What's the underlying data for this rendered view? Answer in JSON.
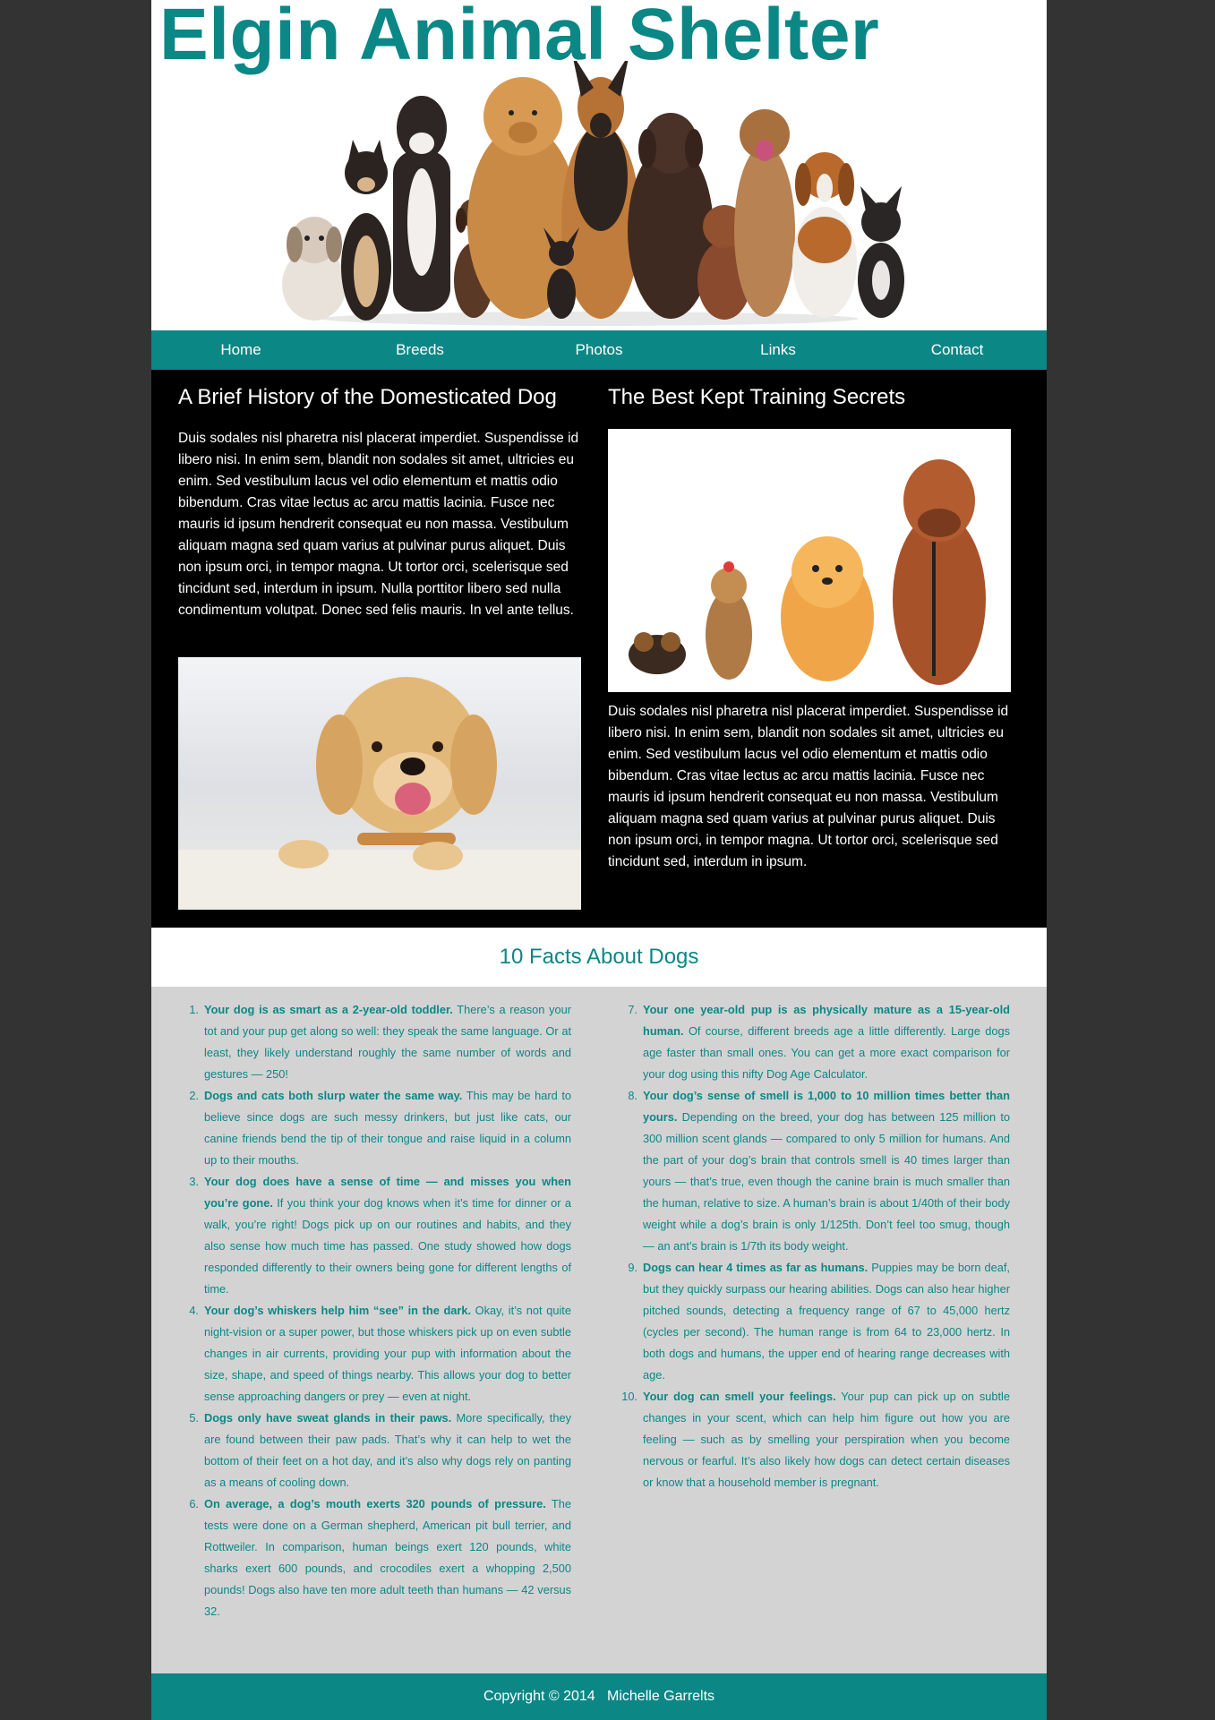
{
  "header": {
    "site_title": "Elgin Animal Shelter",
    "banner_image": "group-of-dogs-banner"
  },
  "nav": {
    "items": [
      {
        "label": "Home"
      },
      {
        "label": "Breeds"
      },
      {
        "label": "Photos"
      },
      {
        "label": "Links"
      },
      {
        "label": "Contact"
      }
    ]
  },
  "main": {
    "left": {
      "title": "A Brief History of the Domesticated Dog",
      "text": "Duis sodales nisl pharetra nisl placerat imperdiet. Suspendisse id libero nisi. In enim sem, blandit non sodales sit amet, ultricies eu enim. Sed vestibulum lacus vel odio elementum et mattis odio bibendum. Cras vitae lectus ac arcu mattis lacinia. Fusce nec mauris id ipsum hendrerit consequat eu non massa. Vestibulum aliquam magna sed quam varius at pulvinar purus aliquet. Duis non ipsum orci, in tempor magna. Ut tortor orci, scelerisque sed tincidunt sed, interdum in ipsum. Nulla porttitor libero sed nulla condimentum volutpat. Donec sed felis mauris. In vel ante tellus.",
      "image": "golden-puppy-photo"
    },
    "right": {
      "title": "The Best Kept Training Secrets",
      "image": "dogs-by-size-photo",
      "text": "Duis sodales nisl pharetra nisl placerat imperdiet. Suspendisse id libero nisi. In enim sem, blandit non sodales sit amet, ultricies eu enim. Sed vestibulum lacus vel odio elementum et mattis odio bibendum. Cras vitae lectus ac arcu mattis lacinia. Fusce nec mauris id ipsum hendrerit consequat eu non massa. Vestibulum aliquam magna sed quam varius at pulvinar purus aliquet. Duis non ipsum orci, in tempor magna. Ut tortor orci, scelerisque sed tincidunt sed, interdum in ipsum."
    }
  },
  "facts": {
    "title": "10 Facts About Dogs",
    "items": [
      {
        "num": "1.",
        "lead": "Your dog is as smart as a 2-year-old toddler.",
        "body": " There’s a reason your tot and your pup get along so well: they speak the same language. Or at least, they likely understand roughly the same number of words and gestures — 250!"
      },
      {
        "num": "2.",
        "lead": "Dogs and cats both slurp water the same way.",
        "body": " This may be hard to believe since dogs are such messy drinkers, but just like cats, our canine friends bend the tip of their tongue and raise liquid in a column up to their mouths."
      },
      {
        "num": "3.",
        "lead": "Your dog does have a sense of time — and misses you when you’re gone.",
        "body": " If you think your dog knows when it’s time for dinner or a walk, you’re right! Dogs pick up on our routines and habits, and they also sense how much time has passed. One study showed how dogs responded differently to their owners being gone for different lengths of time."
      },
      {
        "num": "4.",
        "lead": "Your dog’s whiskers help him “see” in the dark.",
        "body": " Okay, it’s not quite night-vision or a super power, but those whiskers pick up on even subtle changes in air currents, providing your pup with information about the size, shape, and speed of things nearby. This allows your dog to better sense approaching dangers or prey — even at night."
      },
      {
        "num": "5.",
        "lead": "Dogs only have sweat glands in their paws.",
        "body": " More specifically, they are found between their paw pads. That’s why it can help to wet the bottom of their feet on a hot day, and it’s also why dogs rely on panting as a means of cooling down."
      },
      {
        "num": "6.",
        "lead": "On average, a dog’s mouth exerts 320 pounds of pressure.",
        "body": " The tests were done on a German shepherd, American pit bull terrier, and Rottweiler. In comparison, human beings exert 120 pounds, white sharks exert 600 pounds, and crocodiles exert a whopping 2,500 pounds! Dogs also have ten more adult teeth than humans — 42 versus 32."
      },
      {
        "num": "7.",
        "lead": "Your one year-old pup is as physically mature as a 15-year-old human.",
        "body": " Of course, different breeds age a little differently. Large dogs age faster than small ones. You can get a more exact comparison for your dog using this nifty Dog Age Calculator."
      },
      {
        "num": "8.",
        "lead": "Your dog’s sense of smell is 1,000 to 10 million times better than yours.",
        "body": " Depending on the breed, your dog has between 125 million to 300 million scent glands — compared to only 5 million for humans. And the part of your dog’s brain that controls smell is 40 times larger than yours — that’s true, even though the canine brain is much smaller than the human, relative to size. A human’s brain is about 1/40th of their body weight while a dog’s brain is only 1/125th. Don’t feel too smug, though — an ant’s brain is 1/7th its body weight."
      },
      {
        "num": "9.",
        "lead": "Dogs can hear 4 times as far as humans.",
        "body": " Puppies may be born deaf, but they quickly surpass our hearing abilities. Dogs can also hear higher pitched sounds, detecting a frequency range of 67 to 45,000 hertz (cycles per second). The human range is from 64 to 23,000 hertz. In both dogs and humans, the upper end of hearing range decreases with age."
      },
      {
        "num": "10.",
        "lead": "Your dog can smell your feelings.",
        "body": " Your pup can pick up on subtle changes in your scent, which can help him figure out how you are feeling — such as by smelling your perspiration when you become nervous or fearful. It’s also likely how dogs can detect certain diseases or know that a household member is pregnant."
      }
    ]
  },
  "footer": {
    "text": "Copyright © 2014   Michelle Garrelts"
  },
  "colors": {
    "accent": "#0b8786",
    "page_bg": "#333333",
    "main_bg": "#000000",
    "facts_bg": "#d3d3d3"
  }
}
